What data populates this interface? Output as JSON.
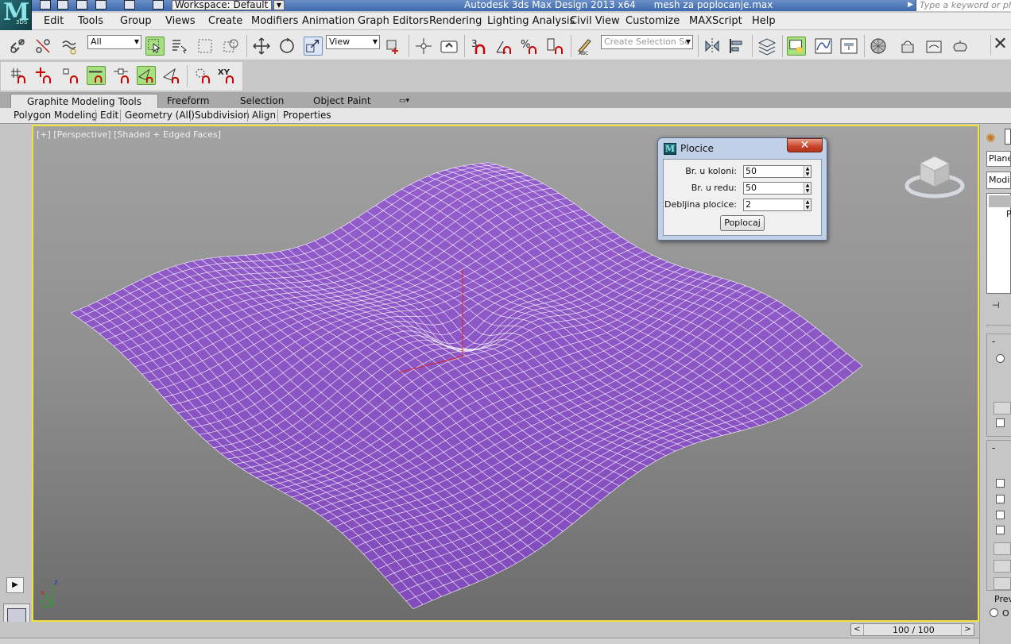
{
  "app": {
    "logo_text": "3DS",
    "workspace": "Workspace: Default",
    "title": "Autodesk 3ds Max Design 2013 x64      mesh za poplocanje.max",
    "search_placeholder": "Type a keyword or phrase"
  },
  "menu": [
    "Edit",
    "Tools",
    "Group",
    "Views",
    "Create",
    "Modifiers",
    "Animation",
    "Graph Editors",
    "Rendering",
    "Lighting Analysis",
    "Civil View",
    "Customize",
    "MAXScript",
    "Help"
  ],
  "toolbar": {
    "selection_filter": "All",
    "ref_coord": "View",
    "selection_set_placeholder": "Create Selection Se"
  },
  "ribbon": {
    "tabs": [
      "Graphite Modeling Tools",
      "Freeform",
      "Selection",
      "Object Paint"
    ],
    "panels": [
      "Polygon Modeling",
      "Edit",
      "Geometry (All)",
      "Subdivision",
      "Align",
      "Properties"
    ]
  },
  "viewport": {
    "label": "[+] [Perspective] [Shaded + Edged Faces]",
    "mesh_color": "#8c55c4",
    "wire_color": "#ffffff",
    "axis_labels": {
      "x": "x",
      "y": "y",
      "z": "z"
    }
  },
  "dialog": {
    "title": "Plocice",
    "close_label": "✕",
    "fields": [
      {
        "label": "Br. u koloni:",
        "value": "50"
      },
      {
        "label": "Br. u redu:",
        "value": "50"
      },
      {
        "label": "Debljina plocice:",
        "value": "2"
      }
    ],
    "button": "Poplocaj"
  },
  "command_panel": {
    "object_name": "PlaneC",
    "modifier_list": "Modifi",
    "stack_item": "Pl",
    "preview_label": "Prev",
    "radio_label": "O"
  },
  "timeline": {
    "frame_label": "100 / 100"
  },
  "icons": {
    "viewcube": "viewcube-icon",
    "play": "play-icon",
    "pin": "pin-icon"
  }
}
